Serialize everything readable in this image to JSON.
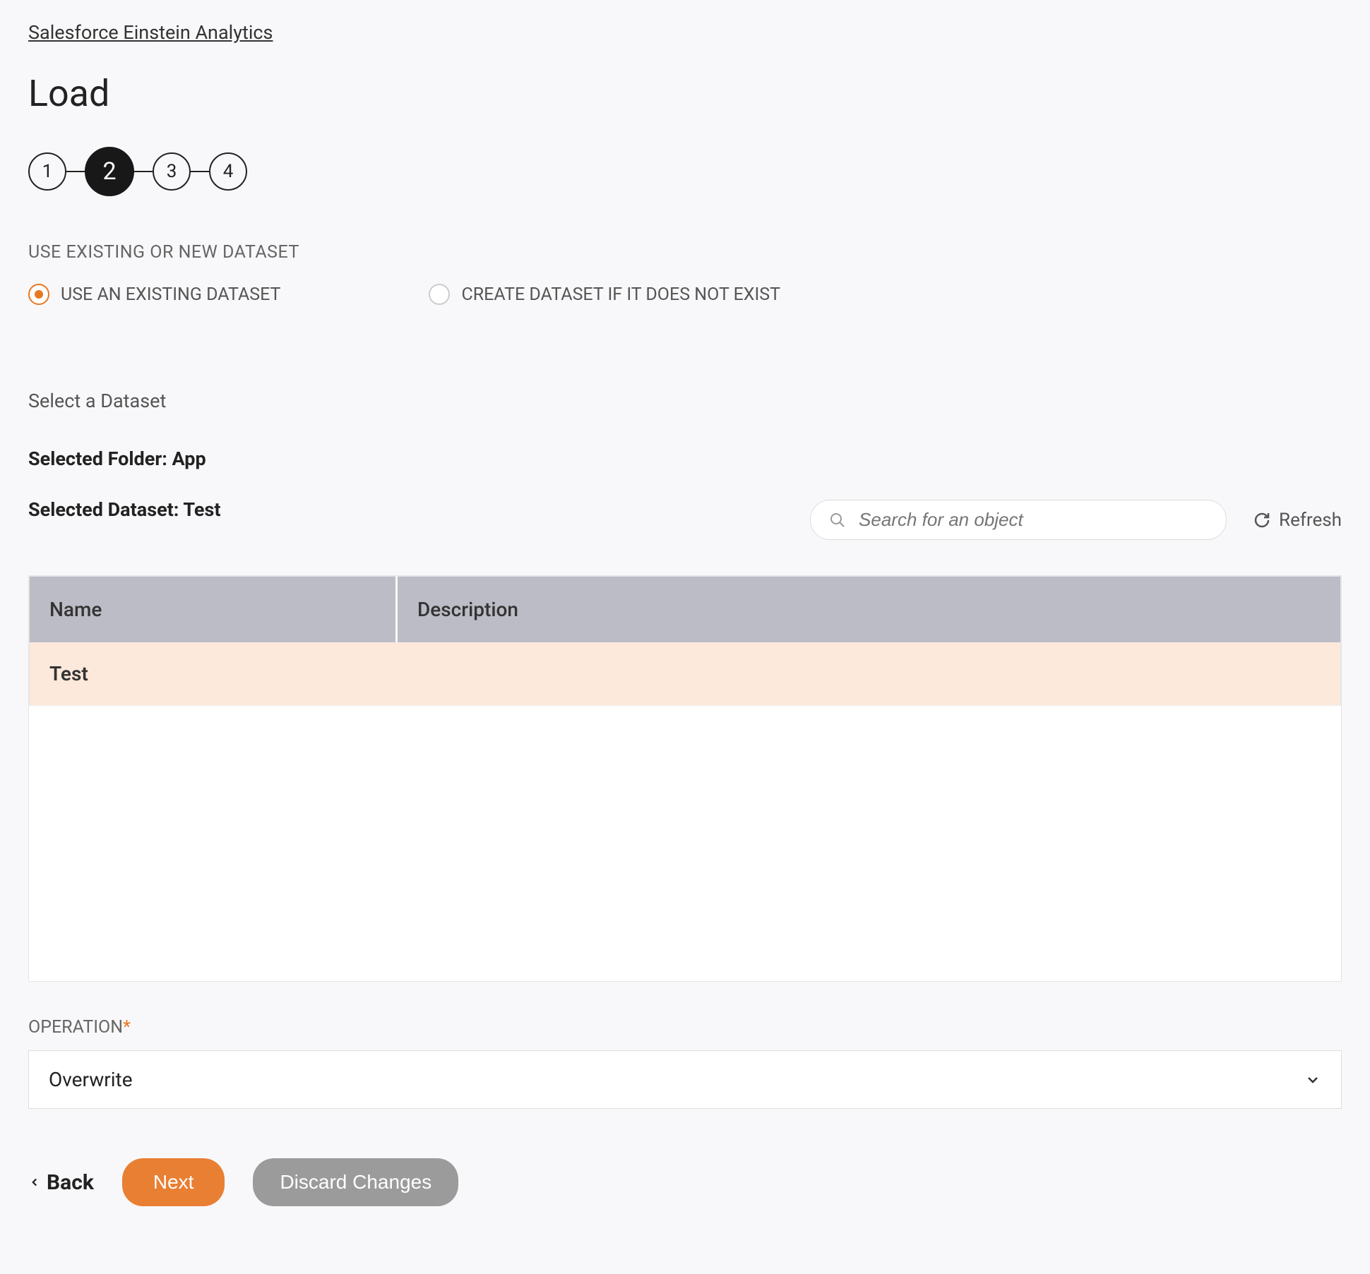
{
  "breadcrumb": "Salesforce Einstein Analytics",
  "page_title": "Load",
  "stepper": {
    "steps": [
      "1",
      "2",
      "3",
      "4"
    ],
    "active_index": 1
  },
  "dataset_mode": {
    "label": "USE EXISTING OR NEW DATASET",
    "option_existing": "USE AN EXISTING DATASET",
    "option_create": "CREATE DATASET IF IT DOES NOT EXIST"
  },
  "select_dataset_label": "Select a Dataset",
  "selected_folder_line": "Selected Folder: App",
  "selected_dataset_line": "Selected Dataset: Test",
  "search": {
    "placeholder": "Search for an object"
  },
  "refresh_label": "Refresh",
  "table": {
    "col_name": "Name",
    "col_description": "Description",
    "rows": [
      {
        "name": "Test",
        "description": ""
      }
    ]
  },
  "operation": {
    "label": "OPERATION",
    "value": "Overwrite"
  },
  "buttons": {
    "back": "Back",
    "next": "Next",
    "discard": "Discard Changes"
  }
}
